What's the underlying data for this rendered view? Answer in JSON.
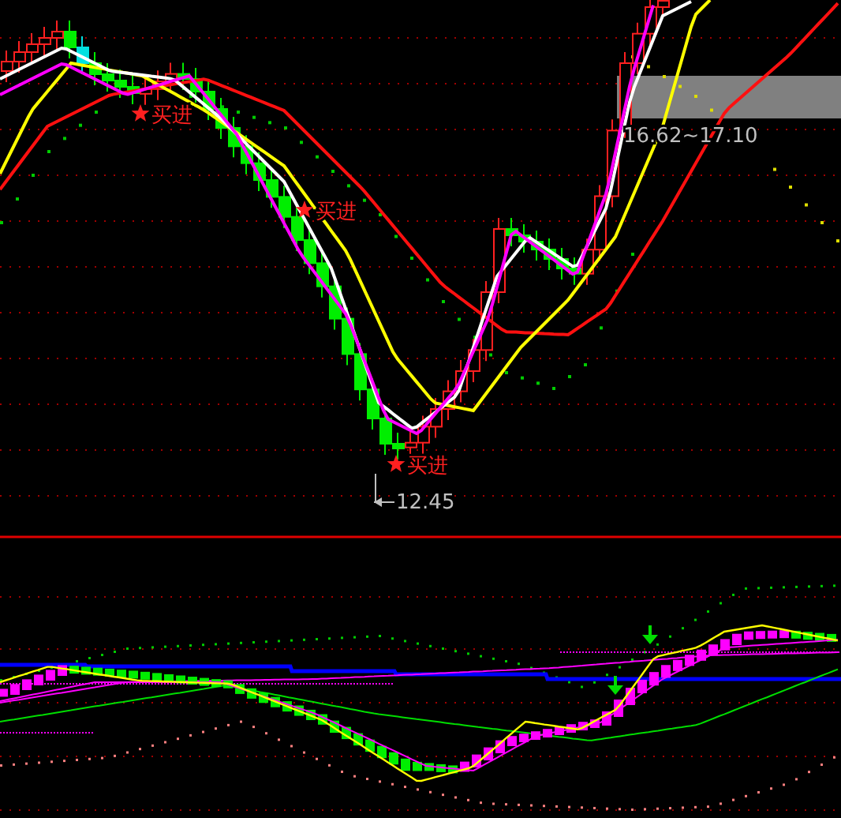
{
  "price_panel": {
    "signals": [
      {
        "label": "买进"
      },
      {
        "label": "买进"
      },
      {
        "label": "买进"
      }
    ],
    "low_label": "12.45",
    "range_label": "16.62~17.10"
  }
}
